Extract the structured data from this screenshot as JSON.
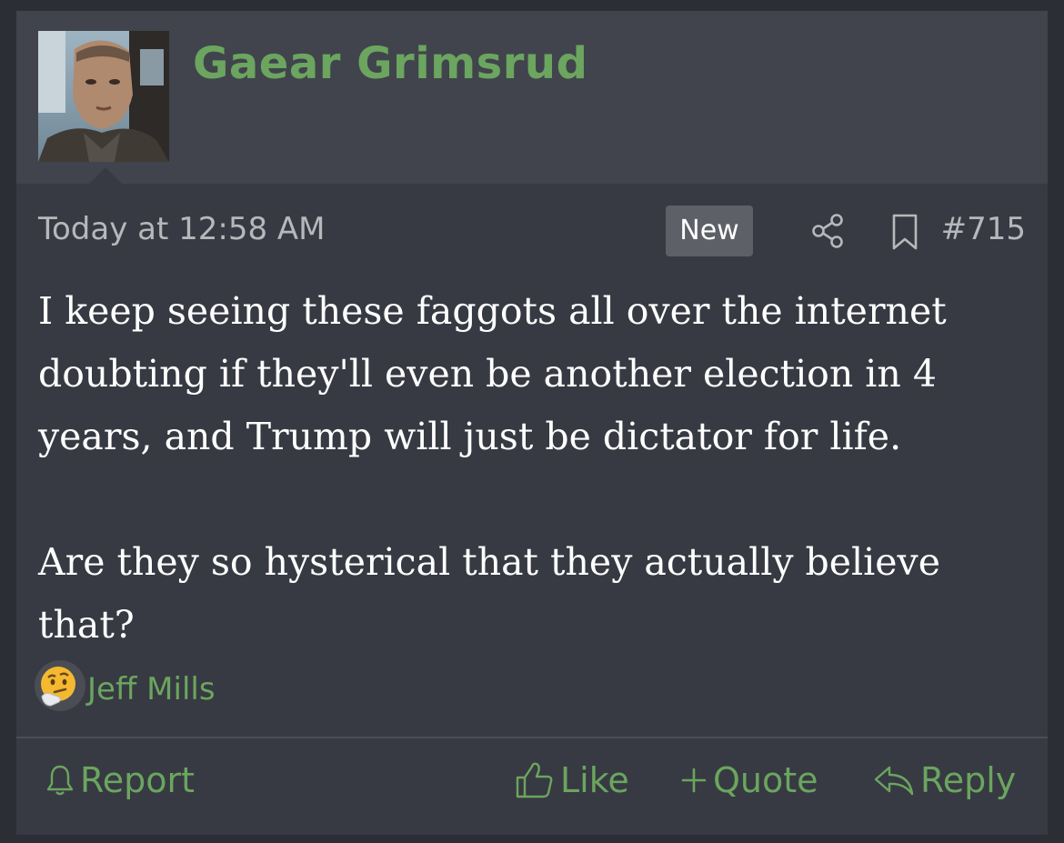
{
  "post": {
    "author": {
      "name": "Gaear Grimsrud",
      "avatar_icon": "user-avatar-photo"
    },
    "date": "Today at 12:58 AM",
    "badge": "New",
    "number": "#715",
    "message": {
      "paragraph_1": "I keep seeing these faggots all over the internet doubting if they'll even be another election in 4 years, and Trump will just be dictator for life.",
      "paragraph_2": "Are they so hysterical that they actually believe that?"
    },
    "reactions": {
      "emoji_icon": "thinking-face-icon",
      "users": "Jeff Mills"
    },
    "actions": {
      "report": "Report",
      "like": "Like",
      "quote": "Quote",
      "reply": "Reply"
    }
  },
  "colors": {
    "page_bg": "#2b2e35",
    "post_bg": "#373a42",
    "user_block_bg": "#41444c",
    "accent_green": "#6ba55f",
    "muted_text": "#b7b8bb",
    "badge_bg": "#5d6066"
  }
}
